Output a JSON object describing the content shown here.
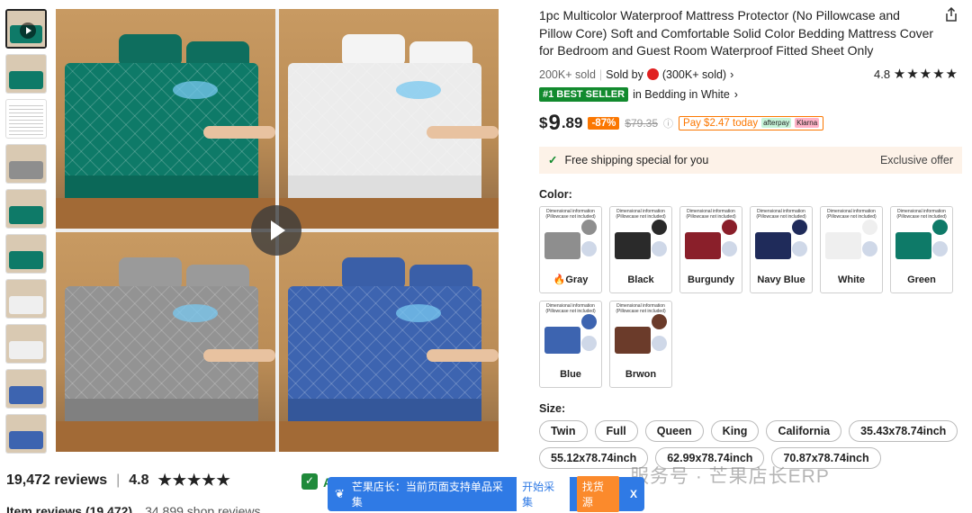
{
  "product": {
    "title": "1pc Multicolor Waterproof Mattress Protector (No Pillowcase and Pillow Core) Soft and Comfortable Solid Color Bedding Mattress Cover for Bedroom and Guest Room Waterproof Fitted Sheet Only",
    "sold": "200K+ sold",
    "sold_by": "Sold by",
    "seller_sold": "(300K+ sold)",
    "rating_value": "4.8",
    "stars": "★★★★★",
    "best_seller_badge": "#1 BEST SELLER",
    "best_seller_text": "in Bedding in White"
  },
  "price": {
    "currency": "$",
    "dollars": "9",
    "cents": ".89",
    "discount": "-87%",
    "original": "$79.35",
    "pay_later": "Pay $2.47 today",
    "klarna": "Klarna",
    "afterpay": "afterpay"
  },
  "shipping": {
    "text": "Free shipping special for you",
    "offer": "Exclusive offer"
  },
  "color_label": "Color:",
  "colors": [
    {
      "name": "Gray",
      "hot": true,
      "color": "#8e8e8e"
    },
    {
      "name": "Black",
      "hot": false,
      "color": "#2a2a2a"
    },
    {
      "name": "Burgundy",
      "hot": false,
      "color": "#8a1f2a"
    },
    {
      "name": "Navy Blue",
      "hot": false,
      "color": "#1f2b5a"
    },
    {
      "name": "White",
      "hot": false,
      "color": "#efefef"
    },
    {
      "name": "Green",
      "hot": false,
      "color": "#0e7a68"
    },
    {
      "name": "Blue",
      "hot": false,
      "color": "#3d64b0"
    },
    {
      "name": "Brwon",
      "hot": false,
      "color": "#6b3b2a"
    }
  ],
  "swatch_header": "Dimensional information",
  "swatch_sub": "(Pillowcase not included)",
  "size_label": "Size:",
  "sizes": [
    "Twin",
    "Full",
    "Queen",
    "King",
    "California",
    "35.43x78.74inch",
    "55.12x78.74inch",
    "62.99x78.74inch",
    "70.87x78.74inch"
  ],
  "reviews": {
    "count": "19,472 reviews",
    "rating": "4.8",
    "stars": "★★★★★",
    "item_reviews": "Item reviews (19,472)",
    "shop_reviews": "34,899 shop reviews"
  },
  "toolbar": {
    "text": "芒果店长：当前页面支持单品采集",
    "start": "开始采集",
    "find": "找货源",
    "close": "X"
  },
  "watermark": "服务号 · 芒果店长ERP",
  "icons": [
    "share-icon",
    "play-icon",
    "check-icon",
    "info-icon",
    "close-icon"
  ]
}
